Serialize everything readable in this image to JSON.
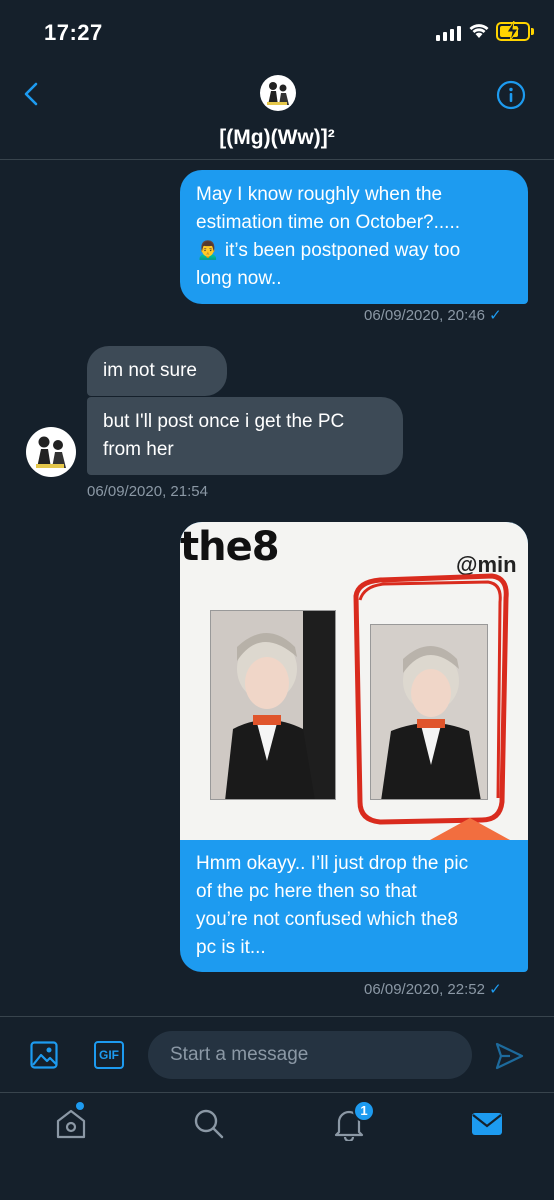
{
  "status_bar": {
    "time": "17:27"
  },
  "header": {
    "title": "[(Mg)(Ww)]²"
  },
  "messages": [
    {
      "direction": "out",
      "lines": [
        "May I know roughly when the",
        "estimation time on October?.....",
        "🙍‍♂️ it’s been postponed way too",
        "long now.."
      ],
      "timestamp": "06/09/2020, 20:46"
    },
    {
      "direction": "in",
      "text": "im not sure"
    },
    {
      "direction": "in",
      "lines": [
        "but I'll post once i get the PC",
        "from her"
      ],
      "timestamp": "06/09/2020, 21:54"
    },
    {
      "direction": "out",
      "photo_text": "the8",
      "photo_handle": "@min",
      "lines": [
        "Hmm okayy.. I’ll just drop the pic",
        "of the pc here then so that",
        "you’re not confused which the8",
        "pc is it..."
      ],
      "timestamp": "06/09/2020, 22:52"
    }
  ],
  "composer": {
    "placeholder": "Start a message",
    "gif_label": "GIF"
  },
  "tabbar": {
    "notifications_badge": "1"
  },
  "colors": {
    "background": "#15202b",
    "accent": "#1d9bf0",
    "incoming_bubble": "#3d4a56",
    "muted_text": "#8b98a5"
  }
}
